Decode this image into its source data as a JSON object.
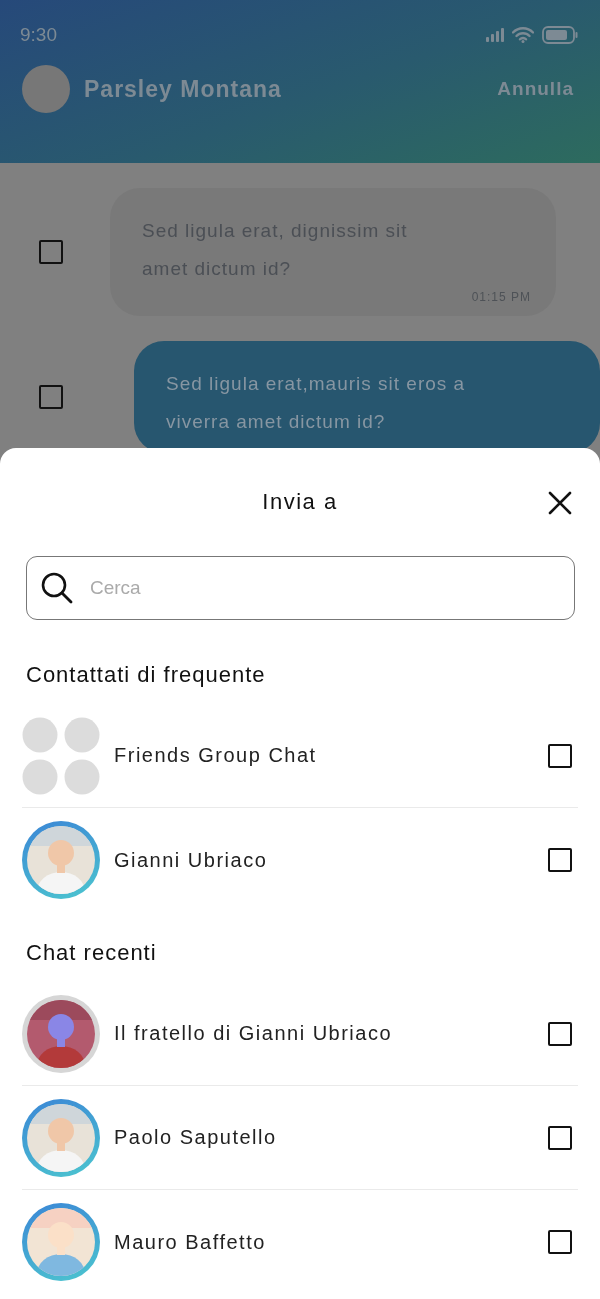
{
  "status_bar": {
    "time": "9:30"
  },
  "header": {
    "name": "Parsley Montana",
    "action": "Annulla"
  },
  "messages": [
    {
      "kind": "received",
      "text": "Sed ligula erat, dignissim sit amet dictum id?",
      "time": "01:15 PM",
      "checked": false
    },
    {
      "kind": "sent",
      "text": "Sed ligula erat,mauris sit eros a viverra amet dictum id?",
      "checked": false
    }
  ],
  "sheet": {
    "title": "Invia a",
    "search": {
      "placeholder": "Cerca"
    },
    "sections": [
      {
        "title": "Contattati di frequente",
        "contacts": [
          {
            "kind": "group",
            "name": "Friends Group Chat",
            "checked": false
          },
          {
            "kind": "person",
            "name": "Gianni Ubriaco",
            "unread": true,
            "checked": false
          }
        ]
      },
      {
        "title": "Chat recenti",
        "contacts": [
          {
            "kind": "person",
            "name": "Il fratello di Gianni Ubriaco",
            "unread": false,
            "checked": false
          },
          {
            "kind": "person",
            "name": "Paolo Saputello",
            "unread": true,
            "checked": false
          },
          {
            "kind": "person",
            "name": "Mauro Baffetto",
            "unread": true,
            "checked": false
          }
        ]
      }
    ]
  }
}
